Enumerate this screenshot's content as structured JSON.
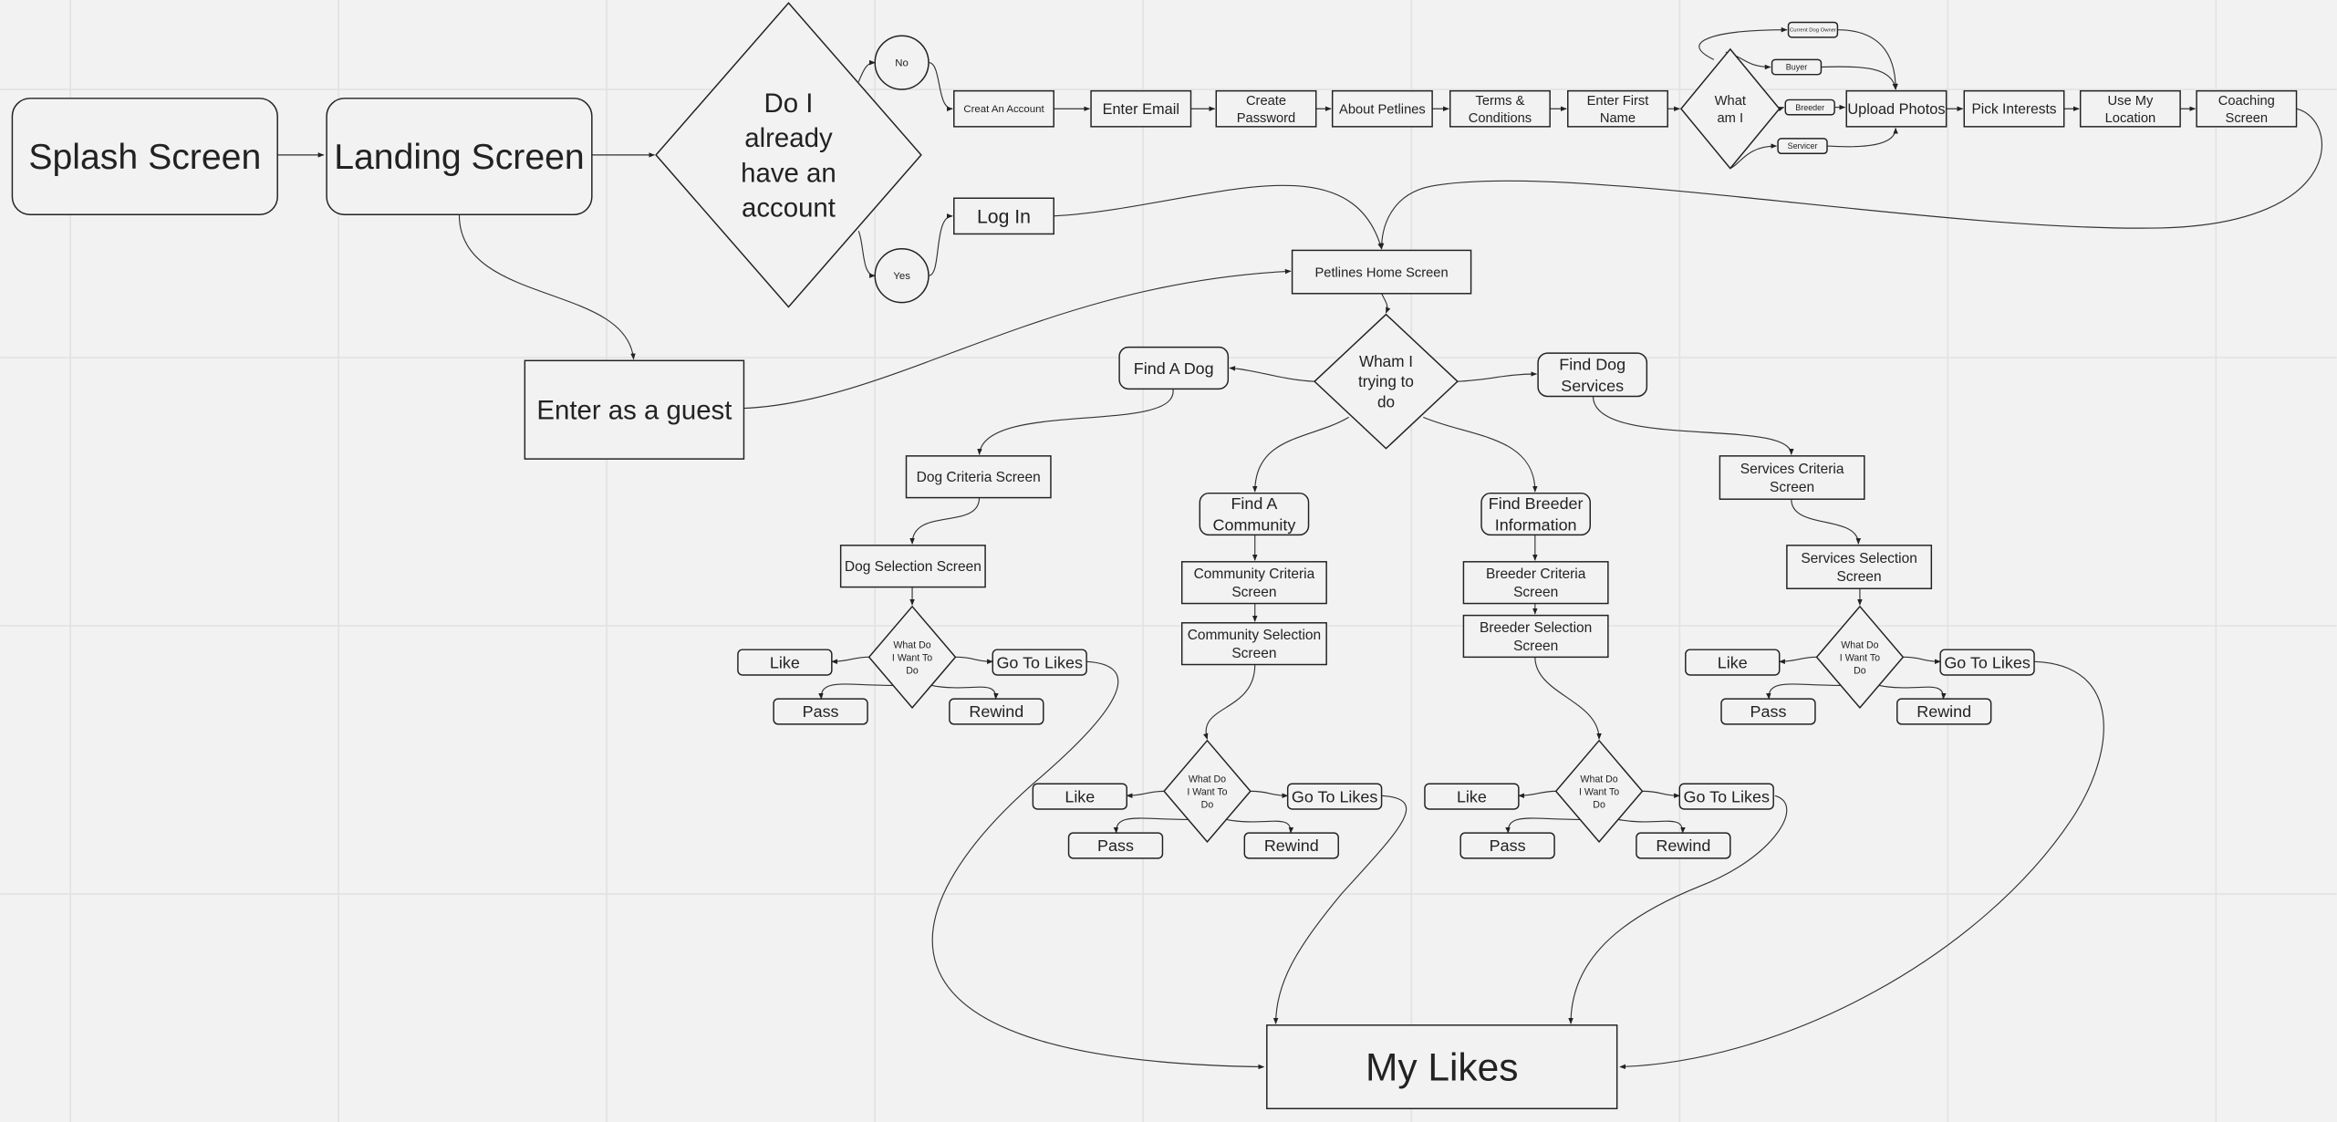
{
  "canvas": {
    "background": "#f2f2f2",
    "grid": true,
    "stroke_color": "#222222"
  },
  "nodes": {
    "splash": {
      "lines": [
        "Splash Screen"
      ],
      "shape": "rounded-rect"
    },
    "landing": {
      "lines": [
        "Landing Screen"
      ],
      "shape": "rounded-rect"
    },
    "account_q": {
      "lines": [
        "Do I",
        "already",
        "have an",
        "account"
      ],
      "shape": "diamond"
    },
    "no": {
      "lines": [
        "No"
      ],
      "shape": "circle"
    },
    "yes": {
      "lines": [
        "Yes"
      ],
      "shape": "circle"
    },
    "creat_account": {
      "lines": [
        "Creat An Account"
      ],
      "shape": "rect"
    },
    "enter_email": {
      "lines": [
        "Enter Email"
      ],
      "shape": "rect"
    },
    "create_password": {
      "lines": [
        "Create",
        "Password"
      ],
      "shape": "rect"
    },
    "about_petlines": {
      "lines": [
        "About Petlines"
      ],
      "shape": "rect"
    },
    "terms": {
      "lines": [
        "Terms &",
        "Conditions"
      ],
      "shape": "rect"
    },
    "first_name": {
      "lines": [
        "Enter First",
        "Name"
      ],
      "shape": "rect"
    },
    "what_am_i": {
      "lines": [
        "What",
        "am I"
      ],
      "shape": "diamond"
    },
    "current_owner": {
      "lines": [
        "Current Dog Owner"
      ],
      "shape": "rounded-rect"
    },
    "buyer": {
      "lines": [
        "Buyer"
      ],
      "shape": "rounded-rect"
    },
    "breeder_role": {
      "lines": [
        "Breeder"
      ],
      "shape": "rounded-rect"
    },
    "servicer": {
      "lines": [
        "Servicer"
      ],
      "shape": "rounded-rect"
    },
    "upload_photos": {
      "lines": [
        "Upload Photos"
      ],
      "shape": "rect"
    },
    "pick_interests": {
      "lines": [
        "Pick Interests"
      ],
      "shape": "rect"
    },
    "use_location": {
      "lines": [
        "Use My",
        "Location"
      ],
      "shape": "rect"
    },
    "coaching": {
      "lines": [
        "Coaching",
        "Screen"
      ],
      "shape": "rect"
    },
    "log_in": {
      "lines": [
        "Log In"
      ],
      "shape": "rect"
    },
    "home": {
      "lines": [
        "Petlines Home Screen"
      ],
      "shape": "rect"
    },
    "guest": {
      "lines": [
        "Enter as a guest"
      ],
      "shape": "rect"
    },
    "wham": {
      "lines": [
        "Wham I",
        "trying to",
        "do"
      ],
      "shape": "diamond"
    },
    "find_dog": {
      "lines": [
        "Find A Dog"
      ],
      "shape": "rounded-rect"
    },
    "find_services": {
      "lines": [
        "Find Dog",
        "Services"
      ],
      "shape": "rounded-rect"
    },
    "dog_criteria": {
      "lines": [
        "Dog Criteria Screen"
      ],
      "shape": "rect"
    },
    "dog_selection": {
      "lines": [
        "Dog Selection Screen"
      ],
      "shape": "rect"
    },
    "find_community": {
      "lines": [
        "Find A",
        "Community"
      ],
      "shape": "rounded-rect"
    },
    "community_criteria": {
      "lines": [
        "Community Criteria",
        "Screen"
      ],
      "shape": "rect"
    },
    "community_selection": {
      "lines": [
        "Community Selection",
        "Screen"
      ],
      "shape": "rect"
    },
    "find_breeder": {
      "lines": [
        "Find Breeder",
        "Information"
      ],
      "shape": "rounded-rect"
    },
    "breeder_criteria": {
      "lines": [
        "Breeder Criteria",
        "Screen"
      ],
      "shape": "rect"
    },
    "breeder_selection": {
      "lines": [
        "Breeder Selection",
        "Screen"
      ],
      "shape": "rect"
    },
    "services_criteria": {
      "lines": [
        "Services Criteria",
        "Screen"
      ],
      "shape": "rect"
    },
    "services_selection": {
      "lines": [
        "Services Selection",
        "Screen"
      ],
      "shape": "rect"
    },
    "my_likes": {
      "lines": [
        "My Likes"
      ],
      "shape": "rect"
    }
  },
  "action_group": {
    "question": [
      "What Do",
      "I Want To",
      "Do"
    ],
    "like": "Like",
    "go_to_likes": "Go To Likes",
    "pass": "Pass",
    "rewind": "Rewind"
  },
  "action_groups": [
    "dog",
    "community",
    "breeder",
    "services"
  ]
}
